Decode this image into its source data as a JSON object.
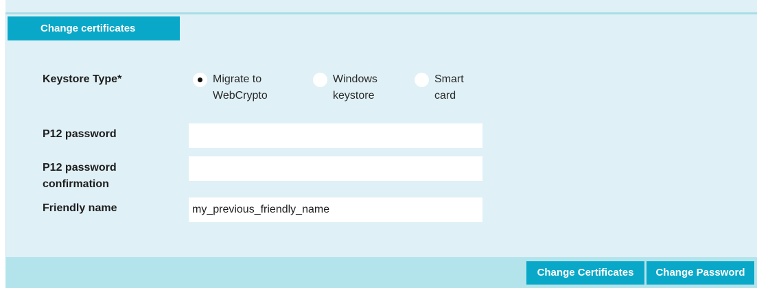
{
  "panel": {
    "tab_title": "Change certificates"
  },
  "form": {
    "keystore_label": "Keystore Type",
    "required_marker": "*",
    "keystore_options": [
      {
        "line1": "Migrate to",
        "line2": "WebCrypto",
        "checked": true
      },
      {
        "line1": "Windows",
        "line2": "keystore",
        "checked": false
      },
      {
        "line1": "Smart",
        "line2": "card",
        "checked": false
      }
    ],
    "p12_password_label": "P12 password",
    "p12_password_value": "",
    "p12_confirm_label": "P12 password confirmation",
    "p12_confirm_value": "",
    "friendly_name_label": "Friendly name",
    "friendly_name_value": "my_previous_friendly_name"
  },
  "footer": {
    "change_certificates_label": "Change Certificates",
    "change_password_label": "Change Password"
  },
  "colors": {
    "accent": "#0aa8c8",
    "panel_bg": "#dff0f6",
    "footer_bg": "#b3e4ec"
  }
}
